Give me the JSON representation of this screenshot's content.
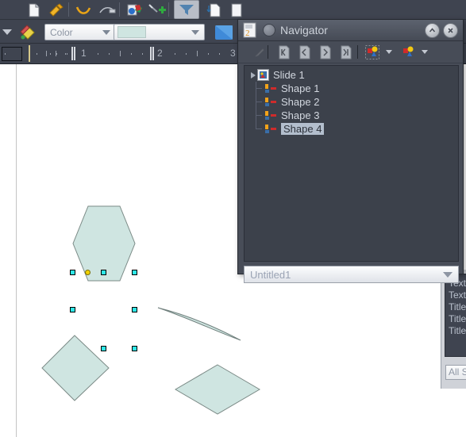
{
  "app": {
    "toolbar_top": {
      "items": [
        {
          "name": "page-icon",
          "glyph": "page"
        },
        {
          "name": "paint-brush-icon",
          "glyph": "brush"
        },
        {
          "name": "curve-icon",
          "glyph": "curve"
        },
        {
          "name": "connector-icon",
          "glyph": "connector"
        },
        {
          "name": "gallery-icon",
          "glyph": "gallery"
        },
        {
          "name": "insert-image-icon",
          "glyph": "insert"
        },
        {
          "name": "filter-icon",
          "glyph": "funnel",
          "pressed": true
        },
        {
          "name": "new-page-icon",
          "glyph": "newpage"
        },
        {
          "name": "layout-icon",
          "glyph": "layout"
        }
      ]
    },
    "toolbar_format": {
      "line_style_label": "Color",
      "fill_value": "",
      "fill_color": "#cfe5e1",
      "items": [
        {
          "name": "dropdown-arrow-icon",
          "glyph": "arrow"
        },
        {
          "name": "fill-bucket-icon",
          "glyph": "bucket"
        },
        {
          "name": "shadow-icon",
          "glyph": "shadow"
        }
      ]
    }
  },
  "ruler": {
    "unit_numbers": [
      "1",
      "2",
      "3"
    ],
    "orientation": "horizontal"
  },
  "canvas": {
    "shapes": [
      {
        "name": "hexagon-shape",
        "label": "Shape 4",
        "selected": true,
        "fill": "#cfe5e1",
        "stroke": "#7b8a86"
      },
      {
        "name": "diamond-shape",
        "label": "Shape 2",
        "selected": false,
        "fill": "#cfe5e1",
        "stroke": "#7b8a86"
      },
      {
        "name": "rhombus-shape",
        "label": "Shape 3",
        "selected": false,
        "fill": "#cfe5e1",
        "stroke": "#7b8a86"
      },
      {
        "name": "sliver-shape",
        "label": "Shape 1",
        "selected": false,
        "fill": "#cfe5e1",
        "stroke": "#7b8a86"
      }
    ]
  },
  "side_panel": {
    "list_items": [
      "Text",
      "Text",
      "Title",
      "Title",
      "Title"
    ],
    "button_label": "All S"
  },
  "navigator": {
    "title": "Navigator",
    "titlebar_buttons": [
      {
        "name": "collapse-button",
        "glyph": "chevron-up"
      },
      {
        "name": "close-button",
        "glyph": "x"
      }
    ],
    "toolbar": [
      {
        "name": "pointer-pen-icon",
        "glyph": "pen"
      },
      {
        "name": "first-page-button",
        "glyph": "first"
      },
      {
        "name": "previous-page-button",
        "glyph": "prev"
      },
      {
        "name": "next-page-button",
        "glyph": "next"
      },
      {
        "name": "last-page-button",
        "glyph": "last"
      },
      {
        "name": "drag-mode-button",
        "glyph": "shape1"
      },
      {
        "name": "drag-mode-dropdown",
        "glyph": "arrow"
      },
      {
        "name": "shapes-button",
        "glyph": "shape2"
      },
      {
        "name": "shapes-dropdown",
        "glyph": "arrow"
      }
    ],
    "tree": {
      "root": {
        "label": "Slide 1",
        "expanded": true
      },
      "children": [
        {
          "label": "Shape 1",
          "selected": false
        },
        {
          "label": "Shape 2",
          "selected": false
        },
        {
          "label": "Shape 3",
          "selected": false
        },
        {
          "label": "Shape 4",
          "selected": true
        }
      ]
    },
    "document_combo": {
      "value": "Untitled1"
    }
  }
}
